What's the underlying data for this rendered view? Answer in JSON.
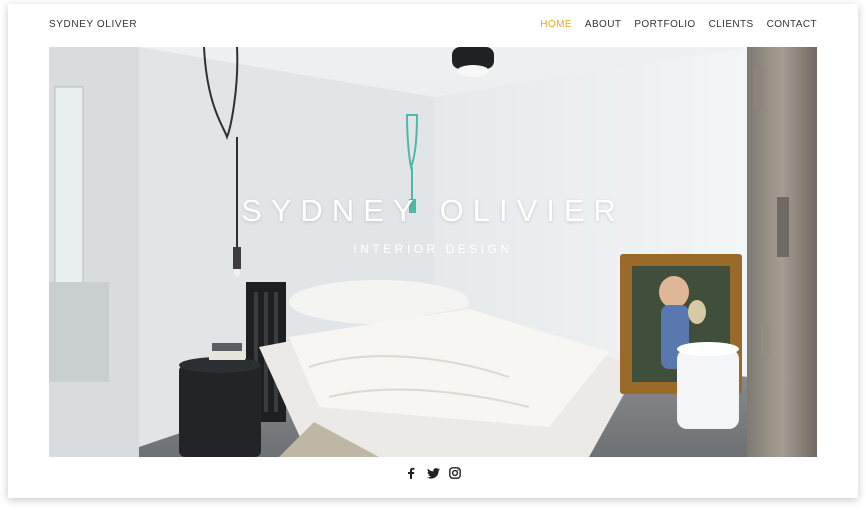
{
  "header": {
    "brand": "SYDNEY OLIVER",
    "nav": [
      {
        "label": "HOME",
        "active": true
      },
      {
        "label": "ABOUT",
        "active": false
      },
      {
        "label": "PORTFOLIO",
        "active": false
      },
      {
        "label": "CLIENTS",
        "active": false
      },
      {
        "label": "CONTACT",
        "active": false
      }
    ]
  },
  "hero": {
    "title": "SYDNEY OLIVIER",
    "subtitle": "INTERIOR DESIGN",
    "image": "bedroom-interior-photo"
  },
  "social": [
    {
      "icon": "facebook-icon"
    },
    {
      "icon": "twitter-icon"
    },
    {
      "icon": "instagram-icon"
    }
  ],
  "colors": {
    "accent": "#e8a536",
    "text": "#333333",
    "background": "#ffffff"
  }
}
